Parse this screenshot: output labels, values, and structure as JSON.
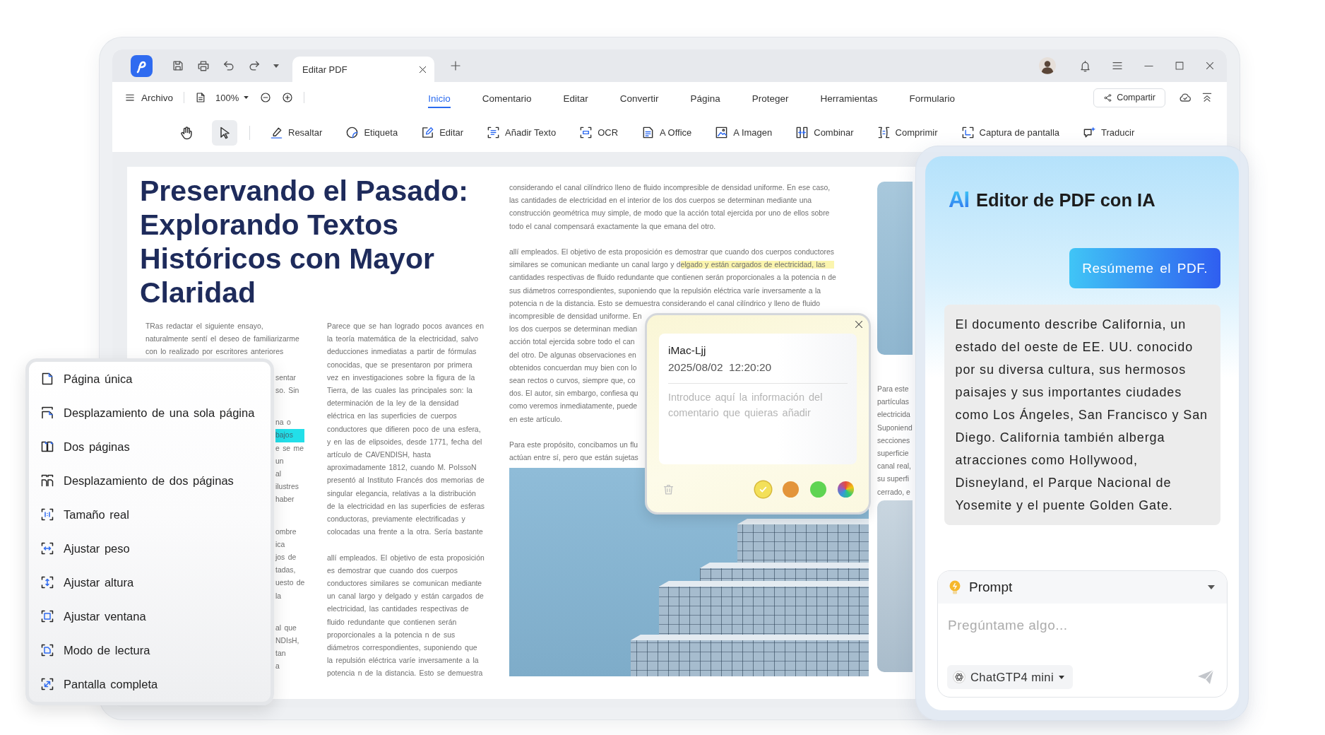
{
  "tab_bar": {
    "tabs": [
      {
        "title": "Editar PDF",
        "selected": true
      }
    ]
  },
  "menu_bar": {
    "file_menu": "Archivo",
    "zoom": "100%",
    "tabs": [
      {
        "label": "Inicio",
        "selected": true
      },
      {
        "label": "Comentario",
        "selected": false
      },
      {
        "label": "Editar",
        "selected": false
      },
      {
        "label": "Convertir",
        "selected": false
      },
      {
        "label": "Página",
        "selected": false
      },
      {
        "label": "Proteger",
        "selected": false
      },
      {
        "label": "Herramientas",
        "selected": false
      },
      {
        "label": "Formulario",
        "selected": false
      }
    ],
    "share_button": "Compartir"
  },
  "toolbar": {
    "modes": [
      {
        "selected": false
      },
      {
        "selected": true
      }
    ],
    "tools": [
      {
        "label": "Resaltar"
      },
      {
        "label": "Etiqueta"
      },
      {
        "label": "Editar"
      },
      {
        "label": "Añadir Texto"
      },
      {
        "label": "OCR"
      },
      {
        "label": "A Office"
      },
      {
        "label": "A Imagen"
      },
      {
        "label": "Combinar"
      },
      {
        "label": "Comprimir"
      },
      {
        "label": "Captura de pantalla"
      },
      {
        "label": "Traducir"
      }
    ]
  },
  "document": {
    "title": "Preservando el Pasado: Explorando Textos Históricos con Mayor Claridad",
    "column_1": {
      "lines": [
        "TRas redactar el siguiente ensayo,",
        "naturalmente sentí el deseo de familiarizarme",
        "con lo realizado por escritores anteriores"
      ],
      "fragments": [
        [
          {
            "text": "sentar",
            "highlighted": false
          },
          {
            "text": "so. Sin",
            "highlighted": false
          }
        ],
        [
          {
            "text": "na o",
            "highlighted": false
          },
          {
            "text": "bajos",
            "highlighted": true
          },
          {
            "text": "e se me",
            "highlighted": false
          },
          {
            "text": "un",
            "highlighted": false
          },
          {
            "text": "al",
            "highlighted": false
          },
          {
            "text": "ilustres",
            "highlighted": false
          },
          {
            "text": "haber",
            "highlighted": false
          }
        ],
        [
          {
            "text": "ombre",
            "highlighted": false
          },
          {
            "text": "ica",
            "highlighted": false
          },
          {
            "text": "jos de",
            "highlighted": false
          },
          {
            "text": "tadas,",
            "highlighted": false
          },
          {
            "text": "uesto de",
            "highlighted": false
          },
          {
            "text": "la",
            "highlighted": false
          }
        ],
        [
          {
            "text": "al que",
            "highlighted": false
          },
          {
            "text": "NDIsH,",
            "highlighted": false
          },
          {
            "text": "tan",
            "highlighted": false
          },
          {
            "text": "a",
            "highlighted": false
          }
        ]
      ]
    },
    "column_2": {
      "paragraphs": [
        [
          "Parece que se han logrado pocos avances en",
          "la teoría matemática de la electricidad, salvo",
          "deducciones inmediatas a partir de fórmulas",
          "conocidas, que se presentaron por primera",
          "vez en investigaciones sobre la figura de la",
          "Tierra, de las cuales las principales son: la",
          "determinación de la ley de la densidad",
          "eléctrica en las superficies de cuerpos",
          "conductores que difieren poco de una esfera,",
          "y en las de elipsoides, desde 1771, fecha del",
          "artículo de CAVENDISH, hasta",
          "aproximadamente 1812, cuando M. PoIssoN",
          "presentó al Instituto Francés dos memorias de",
          "singular elegancia, relativas a la distribución",
          "de la electricidad en las superficies de esferas",
          "conductoras, previamente electrificadas y",
          "colocadas una frente a la otra. Sería bastante"
        ],
        [
          "allí empleados. El objetivo de esta proposición",
          "es demostrar que cuando dos cuerpos",
          "conductores similares se comunican mediante",
          "un canal largo y delgado y están cargados de",
          "electricidad, las cantidades respectivas de",
          "fluido redundante que contienen serán",
          "proporcionales a la potencia n de sus",
          "diámetros correspondientes, suponiendo que",
          "la repulsión eléctrica varíe inversamente a la",
          "potencia n de la distancia. Esto se demuestra"
        ]
      ]
    },
    "column_3": {
      "paragraphs": [
        [
          "considerando el canal cilíndrico lleno de fluido incompresible de densidad uniforme. En ese caso,",
          "las cantidades de electricidad en el interior de los dos cuerpos se determinan mediante una",
          "construcción geométrica muy simple, de modo que la acción total ejercida por uno de ellos sobre",
          "todo el canal compensará exactamente la que emana del otro."
        ],
        [
          "allí empleados. El objetivo de esta proposición es demostrar que cuando dos cuerpos conductores",
          [
            {
              "text": "similares se comunican mediante un canal largo y d",
              "highlighted": false
            },
            {
              "text": "elgado y están cargados de electricidad, las",
              "highlighted": true
            }
          ],
          "cantidades respectivas de fluido redundante que contienen serán proporcionales a la potencia n de",
          "sus diámetros correspondientes, suponiendo que la repulsión eléctrica varíe inversamente a la",
          "potencia n de la distancia. Esto se demuestra considerando el canal cilíndrico y lleno de fluido",
          "incompresible de densidad uniforme. En",
          "los dos cuerpos se determinan median",
          "acción total ejercida sobre todo el can",
          "del otro. De algunas observaciones en",
          "obtenidos concuerdan muy bien con lo",
          "sean rectos o curvos, siempre que, co",
          "dos. El autor, sin embargo, confiesa qu",
          "como veremos inmediatamente, puede",
          "en este artículo."
        ],
        [
          "Para este propósito, concibamos un flu",
          "actúan entre sí, pero que están sujetas"
        ]
      ]
    },
    "column_4": {
      "fragments": [
        "Para este",
        "partículas",
        "electricida",
        "Suponiend",
        "secciones",
        "superficie",
        "canal real,",
        "su superfi",
        "cerrado, e"
      ]
    }
  },
  "view_menu": {
    "items": [
      {
        "label": "Página única"
      },
      {
        "label": "Desplazamiento de una sola página"
      },
      {
        "label": "Dos páginas"
      },
      {
        "label": "Desplazamiento de dos páginas"
      },
      {
        "label": "Tamaño real"
      },
      {
        "label": "Ajustar peso"
      },
      {
        "label": "Ajustar altura"
      },
      {
        "label": "Ajustar ventana"
      },
      {
        "label": "Modo de lectura"
      },
      {
        "label": "Pantalla completa"
      }
    ]
  },
  "comment": {
    "author": "iMac-Ljj",
    "timestamp": "2025/08/02 12:20:20",
    "placeholder": "Introduce aquí la información del comentario que quieras añadir",
    "swatches": [
      {
        "kind": "solid",
        "color": "#f3e05a",
        "selected": true
      },
      {
        "kind": "solid",
        "color": "#e3953a",
        "selected": false
      },
      {
        "kind": "solid",
        "color": "#5fd452",
        "selected": false
      },
      {
        "kind": "wheel",
        "selected": false
      }
    ]
  },
  "ai_panel": {
    "logo": "AI",
    "title": "Editor de PDF con IA",
    "messages": [
      {
        "kind": "user",
        "text": "Resúmeme el PDF."
      },
      {
        "kind": "assistant",
        "text": "El documento describe California, un estado del oeste de EE. UU. conocido por su diversa cultura, sus hermosos paisajes y sus importantes ciudades como Los Ángeles, San Francisco y San Diego. California también alberga atracciones como Hollywood, Disneyland, el Parque Nacional de Yosemite y el puente Golden Gate."
      }
    ],
    "prompt": {
      "label": "Prompt",
      "placeholder": "Pregúntame algo...",
      "model": "ChatGTP4 mini"
    }
  }
}
